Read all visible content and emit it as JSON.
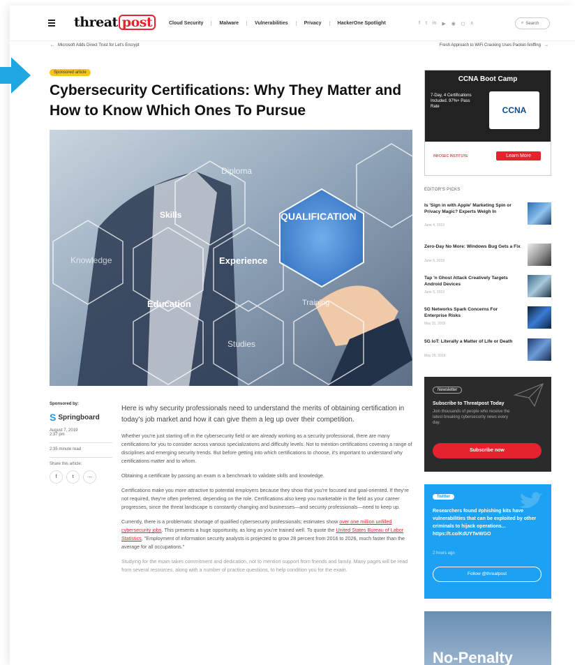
{
  "header": {
    "logo_threat": "threat",
    "logo_post": "post",
    "nav": [
      "Cloud Security",
      "Malware",
      "Vulnerabilities",
      "Privacy",
      "HackerOne Spotlight"
    ],
    "social_icons": [
      "facebook-icon",
      "twitter-icon",
      "linkedin-icon",
      "youtube-icon",
      "rss-icon",
      "instagram-icon",
      "x-icon"
    ],
    "search_label": "Search"
  },
  "subnav": {
    "prev": "Microsoft Adds Direct Trust for Let's Encrypt",
    "next": "Fresh Approach to WiFi Cracking Uses Packet-Sniffing"
  },
  "article": {
    "badge": "Sponsored article",
    "title": "Cybersecurity Certifications: Why They Matter and How to Know Which Ones To Pursue",
    "hero_labels": [
      "Diploma",
      "Skills",
      "QUALIFICATION",
      "Knowledge",
      "Experience",
      "Education",
      "Training",
      "Studies"
    ],
    "sponsored_by_label": "Sponsored by:",
    "sponsor": "Springboard",
    "date": "August 7, 2019",
    "time": "2:37 pm",
    "read_time": "2:35 minute read",
    "share_label": "Share this article:",
    "lead": "Here is why security professionals need to understand the merits of obtaining certification in today's job market and how it can give them a leg up over their competition.",
    "p1": "Whether you're just starting off in the cybersecurity field or are already working as a security professional, there are many certifications for you to consider across various specializations and difficulty levels. Not to mention certifications covering a range of disciplines and emerging security trends. But before getting into which certifications to choose, it's important to understand why certifications matter and to whom.",
    "p2": "Obtaining a certificate by passing an exam is a benchmark to validate skills and knowledge.",
    "p3": "Certifications make you more attractive to potential employers because they show that you're focused and goal-oriented. If they're not required, they're often preferred, depending on the role. Certifications also keep you marketable in the field as your career progresses, since the threat landscape is constantly changing and businesses—and security professionals—need to keep up.",
    "p4a": "Currently, there is a problematic shortage of qualified cybersecurity professionals; estimates show ",
    "p4link1": "over one million unfilled cybersecurity jobs",
    "p4b": ". This presents a huge opportunity, as long as you're trained well. To quote the ",
    "p4link2": "United States Bureau of Labor Statistics",
    "p4c": ", \"Employment of information security analysts is projected to grow 28 percent from 2016 to 2026, much faster than the average for all occupations.\"",
    "p5": "Studying for the exam takes commitment and dedication, not to mention support from friends and family. Many pages will be read from several resources, along with a number of practice questions, to help condition you for the exam."
  },
  "sidebar": {
    "ad1": {
      "title": "CCNA Boot Camp",
      "text": "7-Day, 4 Certifications Included. 97%+ Pass Rate",
      "logo": "CCNA",
      "brand": "INFOSEC INSTITUTE",
      "cta": "Learn More"
    },
    "picks_heading": "EDITOR'S PICKS",
    "picks": [
      {
        "title": "Is 'Sign in with Apple' Marketing Spin or Privacy Magic? Experts Weigh In",
        "date": "June 4, 2019"
      },
      {
        "title": "Zero-Day No More: Windows Bug Gets a Fix",
        "date": "June 6, 2019"
      },
      {
        "title": "Tap 'n Ghost Attack Creatively Targets Android Devices",
        "date": "June 5, 2019"
      },
      {
        "title": "5G Networks Spark Concerns For Enterprise Risks",
        "date": "May 31, 2019"
      },
      {
        "title": "5G IoT: Literally a Matter of Life or Death",
        "date": "May 29, 2019"
      }
    ],
    "newsletter": {
      "tag": "Newsletter",
      "title": "Subscribe to Threatpost Today",
      "text": "Join thousands of people who receive the latest breaking cybersecurity news every day.",
      "cta": "Subscribe now"
    },
    "twitter": {
      "tag": "Twitter",
      "text": "Researchers found #phishing kits have vulnerabilities that can be exploited by other criminals to hijack operations... https://t.co/KdUYTwWGO",
      "ago": "2 hours ago",
      "cta": "Follow @threatpost"
    },
    "ad2": {
      "text": "No-Penalty"
    }
  }
}
